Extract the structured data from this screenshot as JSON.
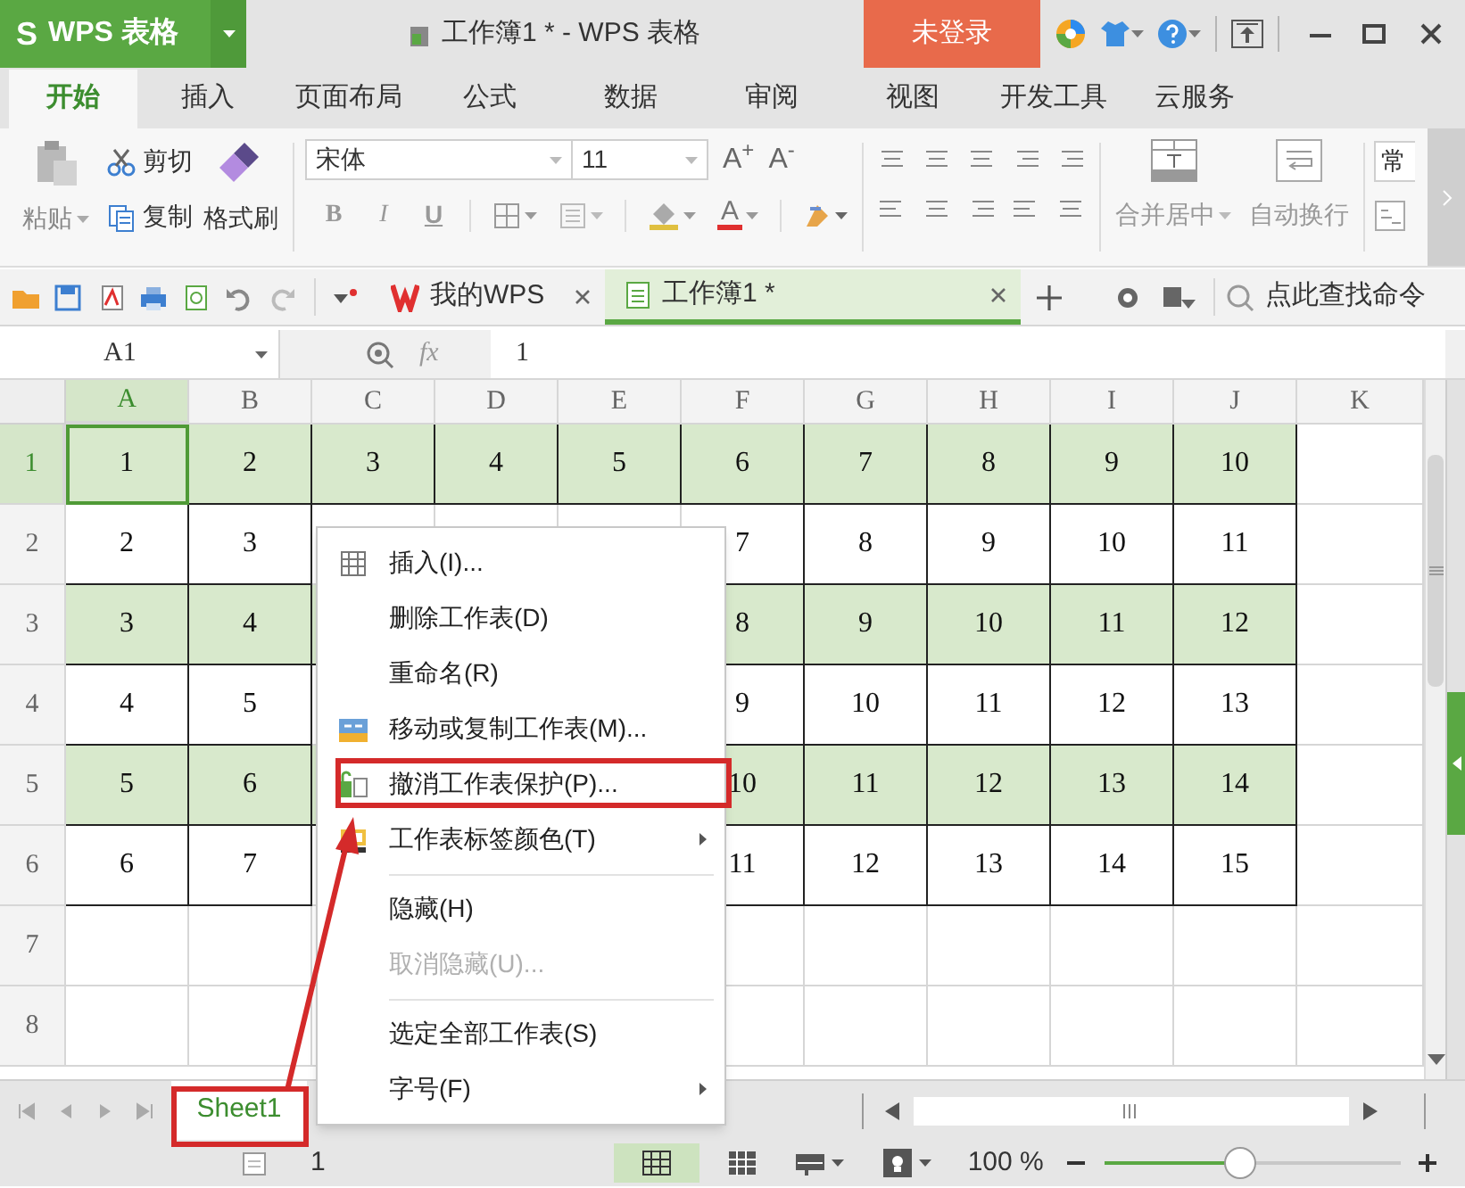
{
  "title_bar": {
    "logo": "S",
    "app_button": "WPS 表格",
    "title": "工作簿1 * - WPS 表格",
    "login_button": "未登录"
  },
  "ribbon_tabs": [
    {
      "label": "开始",
      "selected": true
    },
    {
      "label": "插入",
      "selected": false
    },
    {
      "label": "页面布局",
      "selected": false
    },
    {
      "label": "公式",
      "selected": false
    },
    {
      "label": "数据",
      "selected": false
    },
    {
      "label": "审阅",
      "selected": false
    },
    {
      "label": "视图",
      "selected": false
    },
    {
      "label": "开发工具",
      "selected": false
    },
    {
      "label": "云服务",
      "selected": false
    }
  ],
  "ribbon": {
    "paste": "粘贴",
    "cut": "剪切",
    "copy": "复制",
    "format_painter": "格式刷",
    "font_name": "宋体",
    "font_size": "11",
    "font_size_buttons": [
      "A$^{+}$",
      "A$^{-}$"
    ],
    "style_buttons": [
      "B",
      "I",
      "U"
    ],
    "font_color": "A",
    "merge_center": "合并居中",
    "wrap_text": "自动换行",
    "number_format": "常"
  },
  "doc_tabs": [
    {
      "label": "我的WPS",
      "kind": "home",
      "selected": false
    },
    {
      "label": "工作簿1 *",
      "kind": "workbook",
      "selected": true
    }
  ],
  "command_search": {
    "placeholder": "点此查找命令"
  },
  "formula_bar": {
    "name_box": "A1",
    "fx": "fx",
    "value": "1"
  },
  "grid": {
    "columns": [
      {
        "label": "A",
        "selected": true
      },
      {
        "label": "B",
        "selected": false
      },
      {
        "label": "C",
        "selected": false
      },
      {
        "label": "D",
        "selected": false
      },
      {
        "label": "E",
        "selected": false
      },
      {
        "label": "F",
        "selected": false
      },
      {
        "label": "G",
        "selected": false
      },
      {
        "label": "H",
        "selected": false
      },
      {
        "label": "I",
        "selected": false
      },
      {
        "label": "J",
        "selected": false
      },
      {
        "label": "K",
        "selected": false
      }
    ],
    "rows": [
      {
        "header": "1",
        "selected": true,
        "highlighted": true,
        "cells": [
          "1",
          "2",
          "3",
          "4",
          "5",
          "6",
          "7",
          "8",
          "9",
          "10"
        ]
      },
      {
        "header": "2",
        "selected": false,
        "highlighted": false,
        "cells": [
          "2",
          "3",
          null,
          null,
          null,
          "7",
          "8",
          "9",
          "10",
          "11"
        ]
      },
      {
        "header": "3",
        "selected": false,
        "highlighted": true,
        "cells": [
          "3",
          "4",
          null,
          false,
          false,
          "8",
          "9",
          "10",
          "11",
          "12"
        ]
      },
      {
        "header": "4",
        "selected": false,
        "highlighted": false,
        "cells": [
          "4",
          "5",
          null,
          false,
          false,
          "9",
          "10",
          "11",
          "12",
          "13"
        ]
      },
      {
        "header": "5",
        "selected": false,
        "highlighted": true,
        "cells": [
          "5",
          "6",
          null,
          false,
          false,
          "10",
          "11",
          "12",
          "13",
          "14"
        ]
      },
      {
        "header": "6",
        "selected": false,
        "highlighted": false,
        "cells": [
          "6",
          "7",
          null,
          false,
          false,
          "11",
          "12",
          "13",
          "14",
          "15"
        ]
      },
      {
        "header": "7",
        "selected": false,
        "highlighted": false,
        "cells": [
          null,
          null,
          null,
          false,
          false,
          null,
          null,
          null,
          null,
          null
        ]
      },
      {
        "header": "8",
        "selected": false,
        "highlighted": false,
        "cells": [
          null,
          null,
          null,
          false,
          false,
          null,
          null,
          null,
          null,
          null
        ]
      }
    ]
  },
  "context_menu": [
    {
      "kind": "item",
      "label": "插入(I)...",
      "disabled": false,
      "submenu": false,
      "annotated": false
    },
    {
      "kind": "item",
      "label": "删除工作表(D)",
      "disabled": false,
      "submenu": false,
      "annotated": false
    },
    {
      "kind": "item",
      "label": "重命名(R)",
      "disabled": false,
      "submenu": false,
      "annotated": false
    },
    {
      "kind": "item",
      "label": "移动或复制工作表(M)...",
      "disabled": false,
      "submenu": false,
      "annotated": false
    },
    {
      "kind": "item",
      "label": "撤消工作表保护(P)...",
      "disabled": false,
      "submenu": false,
      "annotated": true
    },
    {
      "kind": "item",
      "label": "工作表标签颜色(T)",
      "disabled": false,
      "submenu": true,
      "annotated": false
    },
    {
      "kind": "separator"
    },
    {
      "kind": "item",
      "label": "隐藏(H)",
      "disabled": false,
      "submenu": false,
      "annotated": false
    },
    {
      "kind": "item",
      "label": "取消隐藏(U)...",
      "disabled": true,
      "submenu": false,
      "annotated": false
    },
    {
      "kind": "separator"
    },
    {
      "kind": "item",
      "label": "选定全部工作表(S)",
      "disabled": false,
      "submenu": false,
      "annotated": false
    },
    {
      "kind": "item",
      "label": "字号(F)",
      "disabled": false,
      "submenu": true,
      "annotated": false
    }
  ],
  "sheet_tabs": [
    {
      "label": "Sheet1",
      "selected": true,
      "annotated": true
    }
  ],
  "annotation_arrow": true,
  "status_bar": {
    "count": "1",
    "zoom": "100 %",
    "zoom_slider": {
      "level": 0.46
    }
  }
}
